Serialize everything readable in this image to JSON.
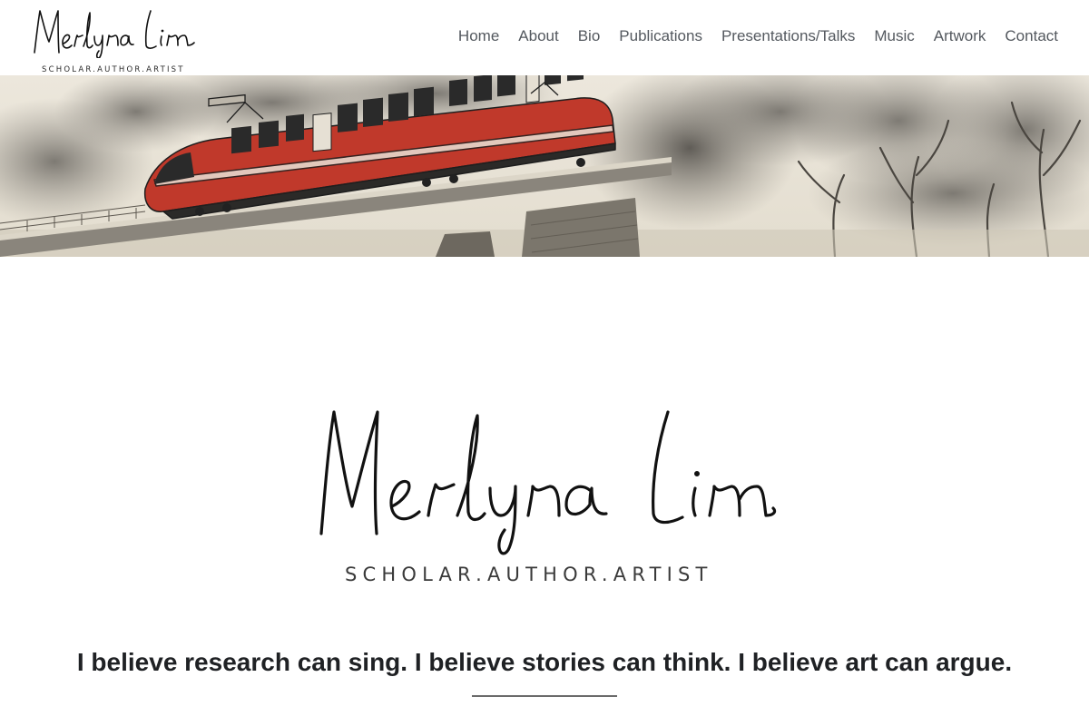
{
  "site": {
    "logo_name": "Merlyna Lim",
    "logo_tagline": "SCHOLAR.AUTHOR.ARTIST"
  },
  "nav": {
    "items": [
      {
        "label": "Home"
      },
      {
        "label": "About"
      },
      {
        "label": "Bio"
      },
      {
        "label": "Publications"
      },
      {
        "label": "Presentations/Talks"
      },
      {
        "label": "Music"
      },
      {
        "label": "Artwork"
      },
      {
        "label": "Contact"
      }
    ]
  },
  "banner": {
    "image": "watercolor-train-on-bridge-illustration"
  },
  "hero": {
    "logo_name": "Merlyna Lim",
    "logo_tagline": "SCHOLAR.AUTHOR.ARTIST",
    "tagline": "I believe research can sing. I believe stories can think. I believe art can argue."
  },
  "colors": {
    "nav_text": "#54595f",
    "heading": "#1f2124",
    "train_red": "#c0392b",
    "divider": "#6b6b6b"
  }
}
